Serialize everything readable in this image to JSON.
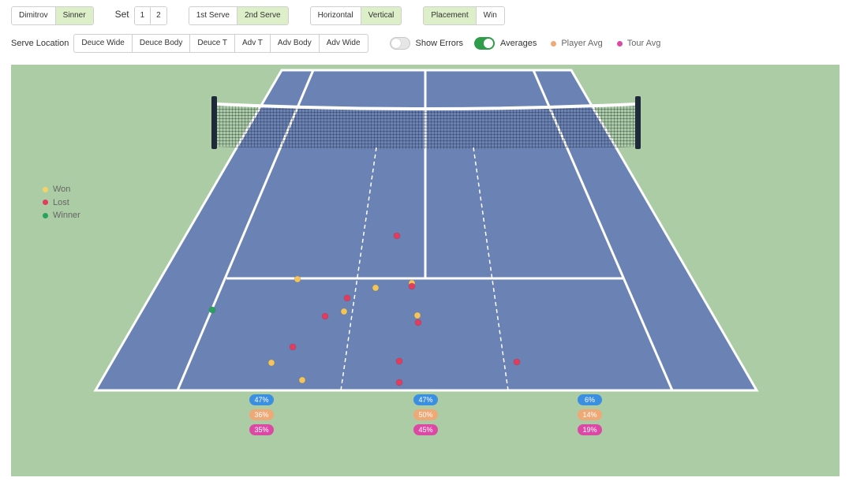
{
  "players": {
    "items": [
      "Dimitrov",
      "Sinner"
    ],
    "active": 1
  },
  "set": {
    "label": "Set",
    "items": [
      "1",
      "2"
    ]
  },
  "serve": {
    "items": [
      "1st Serve",
      "2nd Serve"
    ],
    "active": 1
  },
  "orientation": {
    "items": [
      "Horizontal",
      "Vertical"
    ],
    "active": 1
  },
  "mode": {
    "items": [
      "Placement",
      "Win"
    ],
    "active": 0
  },
  "serve_location": {
    "label": "Serve Location",
    "items": [
      "Deuce Wide",
      "Deuce Body",
      "Deuce T",
      "Adv T",
      "Adv Body",
      "Adv Wide"
    ]
  },
  "toggles": {
    "show_errors": {
      "label": "Show Errors",
      "on": false
    },
    "averages": {
      "label": "Averages",
      "on": true
    }
  },
  "averages_legend": [
    {
      "label": "Player Avg",
      "color": "#efa977"
    },
    {
      "label": "Tour Avg",
      "color": "#dc49a5"
    }
  ],
  "outcome_legend": [
    {
      "label": "Won",
      "color": "#f4d36b"
    },
    {
      "label": "Lost",
      "color": "#e23d5e"
    },
    {
      "label": "Winner",
      "color": "#27a35a"
    }
  ],
  "zones": [
    {
      "player": "47%",
      "player_avg": "36%",
      "tour_avg": "35%"
    },
    {
      "player": "47%",
      "player_avg": "50%",
      "tour_avg": "45%"
    },
    {
      "player": "6%",
      "player_avg": "14%",
      "tour_avg": "19%"
    }
  ],
  "colors": {
    "court": "#6a82b4",
    "surround": "#abcca4",
    "active_button": "#dcefc8"
  }
}
